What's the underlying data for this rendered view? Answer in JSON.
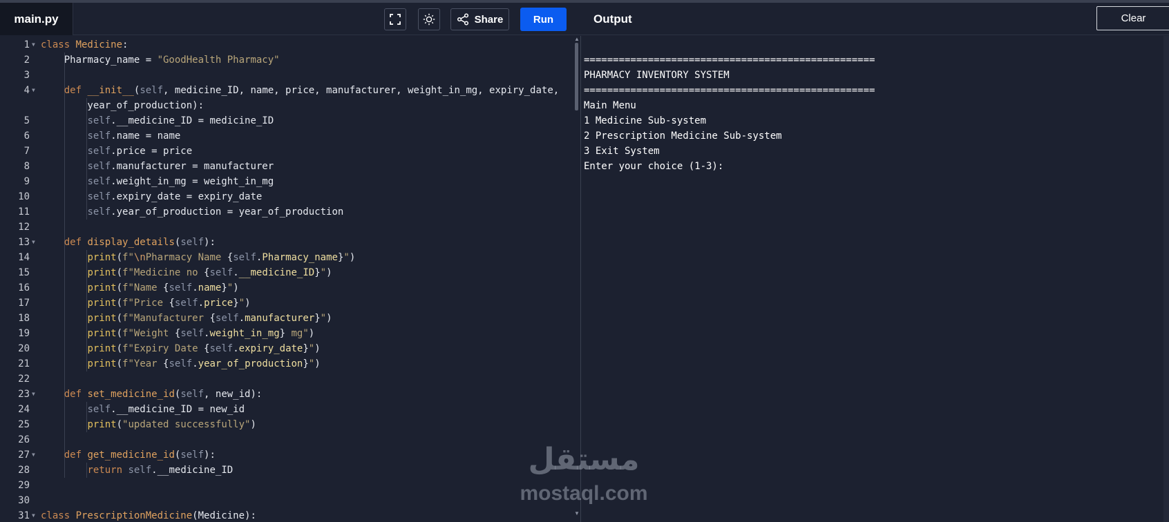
{
  "header": {
    "file_tab": "main.py",
    "share_label": "Share",
    "run_label": "Run",
    "output_title": "Output",
    "clear_label": "Clear",
    "icons": {
      "fullscreen": "fullscreen-icon",
      "theme": "sun-icon",
      "share": "share-icon"
    }
  },
  "editor": {
    "lines": [
      {
        "n": "1",
        "fold": true
      },
      {
        "n": "2"
      },
      {
        "n": "3"
      },
      {
        "n": "4",
        "fold": true
      },
      {
        "n": ""
      },
      {
        "n": "5"
      },
      {
        "n": "6"
      },
      {
        "n": "7"
      },
      {
        "n": "8"
      },
      {
        "n": "9"
      },
      {
        "n": "10"
      },
      {
        "n": "11"
      },
      {
        "n": "12"
      },
      {
        "n": "13",
        "fold": true
      },
      {
        "n": "14"
      },
      {
        "n": "15"
      },
      {
        "n": "16"
      },
      {
        "n": "17"
      },
      {
        "n": "18"
      },
      {
        "n": "19"
      },
      {
        "n": "20"
      },
      {
        "n": "21"
      },
      {
        "n": "22"
      },
      {
        "n": "23",
        "fold": true
      },
      {
        "n": "24"
      },
      {
        "n": "25"
      },
      {
        "n": "26"
      },
      {
        "n": "27",
        "fold": true
      },
      {
        "n": "28"
      },
      {
        "n": "29"
      },
      {
        "n": "30"
      },
      {
        "n": "31",
        "fold": true
      }
    ],
    "code": [
      [
        [
          "k",
          "class "
        ],
        [
          "cn",
          "Medicine"
        ],
        [
          "p",
          ":"
        ]
      ],
      [
        [
          "p",
          "    Pharmacy_name = "
        ],
        [
          "s",
          "\"GoodHealth Pharmacy\""
        ]
      ],
      [],
      [
        [
          "p",
          "    "
        ],
        [
          "k",
          "def "
        ],
        [
          "cn",
          "__init__"
        ],
        [
          "p",
          "("
        ],
        [
          "sf",
          "self"
        ],
        [
          "p",
          ", medicine_ID, name, price, manufacturer, weight_in_mg, expiry_date,"
        ]
      ],
      [
        [
          "p",
          "        year_of_production):"
        ]
      ],
      [
        [
          "p",
          "        "
        ],
        [
          "sf",
          "self"
        ],
        [
          "p",
          ".__medicine_ID = medicine_ID"
        ]
      ],
      [
        [
          "p",
          "        "
        ],
        [
          "sf",
          "self"
        ],
        [
          "p",
          ".name = name"
        ]
      ],
      [
        [
          "p",
          "        "
        ],
        [
          "sf",
          "self"
        ],
        [
          "p",
          ".price = price"
        ]
      ],
      [
        [
          "p",
          "        "
        ],
        [
          "sf",
          "self"
        ],
        [
          "p",
          ".manufacturer = manufacturer"
        ]
      ],
      [
        [
          "p",
          "        "
        ],
        [
          "sf",
          "self"
        ],
        [
          "p",
          ".weight_in_mg = weight_in_mg"
        ]
      ],
      [
        [
          "p",
          "        "
        ],
        [
          "sf",
          "self"
        ],
        [
          "p",
          ".expiry_date = expiry_date"
        ]
      ],
      [
        [
          "p",
          "        "
        ],
        [
          "sf",
          "self"
        ],
        [
          "p",
          ".year_of_production = year_of_production"
        ]
      ],
      [],
      [
        [
          "p",
          "    "
        ],
        [
          "k",
          "def "
        ],
        [
          "cn",
          "display_details"
        ],
        [
          "p",
          "("
        ],
        [
          "sf",
          "self"
        ],
        [
          "p",
          "):"
        ]
      ],
      [
        [
          "p",
          "        "
        ],
        [
          "bi",
          "print"
        ],
        [
          "p",
          "("
        ],
        [
          "s",
          "f\""
        ],
        [
          "esc",
          "\\n"
        ],
        [
          "s",
          "Pharmacy Name "
        ],
        [
          "p",
          "{"
        ],
        [
          "sf",
          "self"
        ],
        [
          "p",
          "."
        ],
        [
          "attr",
          "Pharmacy_name"
        ],
        [
          "p",
          "}"
        ],
        [
          "s",
          "\""
        ],
        [
          "p",
          ")"
        ]
      ],
      [
        [
          "p",
          "        "
        ],
        [
          "bi",
          "print"
        ],
        [
          "p",
          "("
        ],
        [
          "s",
          "f\"Medicine no "
        ],
        [
          "p",
          "{"
        ],
        [
          "sf",
          "self"
        ],
        [
          "p",
          "."
        ],
        [
          "attr",
          "__medicine_ID"
        ],
        [
          "p",
          "}"
        ],
        [
          "s",
          "\""
        ],
        [
          "p",
          ")"
        ]
      ],
      [
        [
          "p",
          "        "
        ],
        [
          "bi",
          "print"
        ],
        [
          "p",
          "("
        ],
        [
          "s",
          "f\"Name "
        ],
        [
          "p",
          "{"
        ],
        [
          "sf",
          "self"
        ],
        [
          "p",
          "."
        ],
        [
          "attr",
          "name"
        ],
        [
          "p",
          "}"
        ],
        [
          "s",
          "\""
        ],
        [
          "p",
          ")"
        ]
      ],
      [
        [
          "p",
          "        "
        ],
        [
          "bi",
          "print"
        ],
        [
          "p",
          "("
        ],
        [
          "s",
          "f\"Price "
        ],
        [
          "p",
          "{"
        ],
        [
          "sf",
          "self"
        ],
        [
          "p",
          "."
        ],
        [
          "attr",
          "price"
        ],
        [
          "p",
          "}"
        ],
        [
          "s",
          "\""
        ],
        [
          "p",
          ")"
        ]
      ],
      [
        [
          "p",
          "        "
        ],
        [
          "bi",
          "print"
        ],
        [
          "p",
          "("
        ],
        [
          "s",
          "f\"Manufacturer "
        ],
        [
          "p",
          "{"
        ],
        [
          "sf",
          "self"
        ],
        [
          "p",
          "."
        ],
        [
          "attr",
          "manufacturer"
        ],
        [
          "p",
          "}"
        ],
        [
          "s",
          "\""
        ],
        [
          "p",
          ")"
        ]
      ],
      [
        [
          "p",
          "        "
        ],
        [
          "bi",
          "print"
        ],
        [
          "p",
          "("
        ],
        [
          "s",
          "f\"Weight "
        ],
        [
          "p",
          "{"
        ],
        [
          "sf",
          "self"
        ],
        [
          "p",
          "."
        ],
        [
          "attr",
          "weight_in_mg"
        ],
        [
          "p",
          "}"
        ],
        [
          "s",
          " mg\""
        ],
        [
          "p",
          ")"
        ]
      ],
      [
        [
          "p",
          "        "
        ],
        [
          "bi",
          "print"
        ],
        [
          "p",
          "("
        ],
        [
          "s",
          "f\"Expiry Date "
        ],
        [
          "p",
          "{"
        ],
        [
          "sf",
          "self"
        ],
        [
          "p",
          "."
        ],
        [
          "attr",
          "expiry_date"
        ],
        [
          "p",
          "}"
        ],
        [
          "s",
          "\""
        ],
        [
          "p",
          ")"
        ]
      ],
      [
        [
          "p",
          "        "
        ],
        [
          "bi",
          "print"
        ],
        [
          "p",
          "("
        ],
        [
          "s",
          "f\"Year "
        ],
        [
          "p",
          "{"
        ],
        [
          "sf",
          "self"
        ],
        [
          "p",
          "."
        ],
        [
          "attr",
          "year_of_production"
        ],
        [
          "p",
          "}"
        ],
        [
          "s",
          "\""
        ],
        [
          "p",
          ")"
        ]
      ],
      [],
      [
        [
          "p",
          "    "
        ],
        [
          "k",
          "def "
        ],
        [
          "cn",
          "set_medicine_id"
        ],
        [
          "p",
          "("
        ],
        [
          "sf",
          "self"
        ],
        [
          "p",
          ", new_id):"
        ]
      ],
      [
        [
          "p",
          "        "
        ],
        [
          "sf",
          "self"
        ],
        [
          "p",
          ".__medicine_ID = new_id"
        ]
      ],
      [
        [
          "p",
          "        "
        ],
        [
          "bi",
          "print"
        ],
        [
          "p",
          "("
        ],
        [
          "s",
          "\"updated successfully\""
        ],
        [
          "p",
          ")"
        ]
      ],
      [],
      [
        [
          "p",
          "    "
        ],
        [
          "k",
          "def "
        ],
        [
          "cn",
          "get_medicine_id"
        ],
        [
          "p",
          "("
        ],
        [
          "sf",
          "self"
        ],
        [
          "p",
          "):"
        ]
      ],
      [
        [
          "p",
          "        "
        ],
        [
          "k",
          "return "
        ],
        [
          "sf",
          "self"
        ],
        [
          "p",
          ".__medicine_ID"
        ]
      ],
      [],
      [],
      [
        [
          "k",
          "class "
        ],
        [
          "cn",
          "PrescriptionMedicine"
        ],
        [
          "p",
          "(Medicine):"
        ]
      ]
    ]
  },
  "output": {
    "lines": [
      "",
      "==================================================",
      "PHARMACY INVENTORY SYSTEM",
      "==================================================",
      "Main Menu",
      "1 Medicine Sub-system",
      "2 Prescription Medicine Sub-system",
      "3 Exit System",
      "Enter your choice (1-3):"
    ]
  },
  "watermark": {
    "arabic": "مستقل",
    "latin": "mostaql.com"
  }
}
